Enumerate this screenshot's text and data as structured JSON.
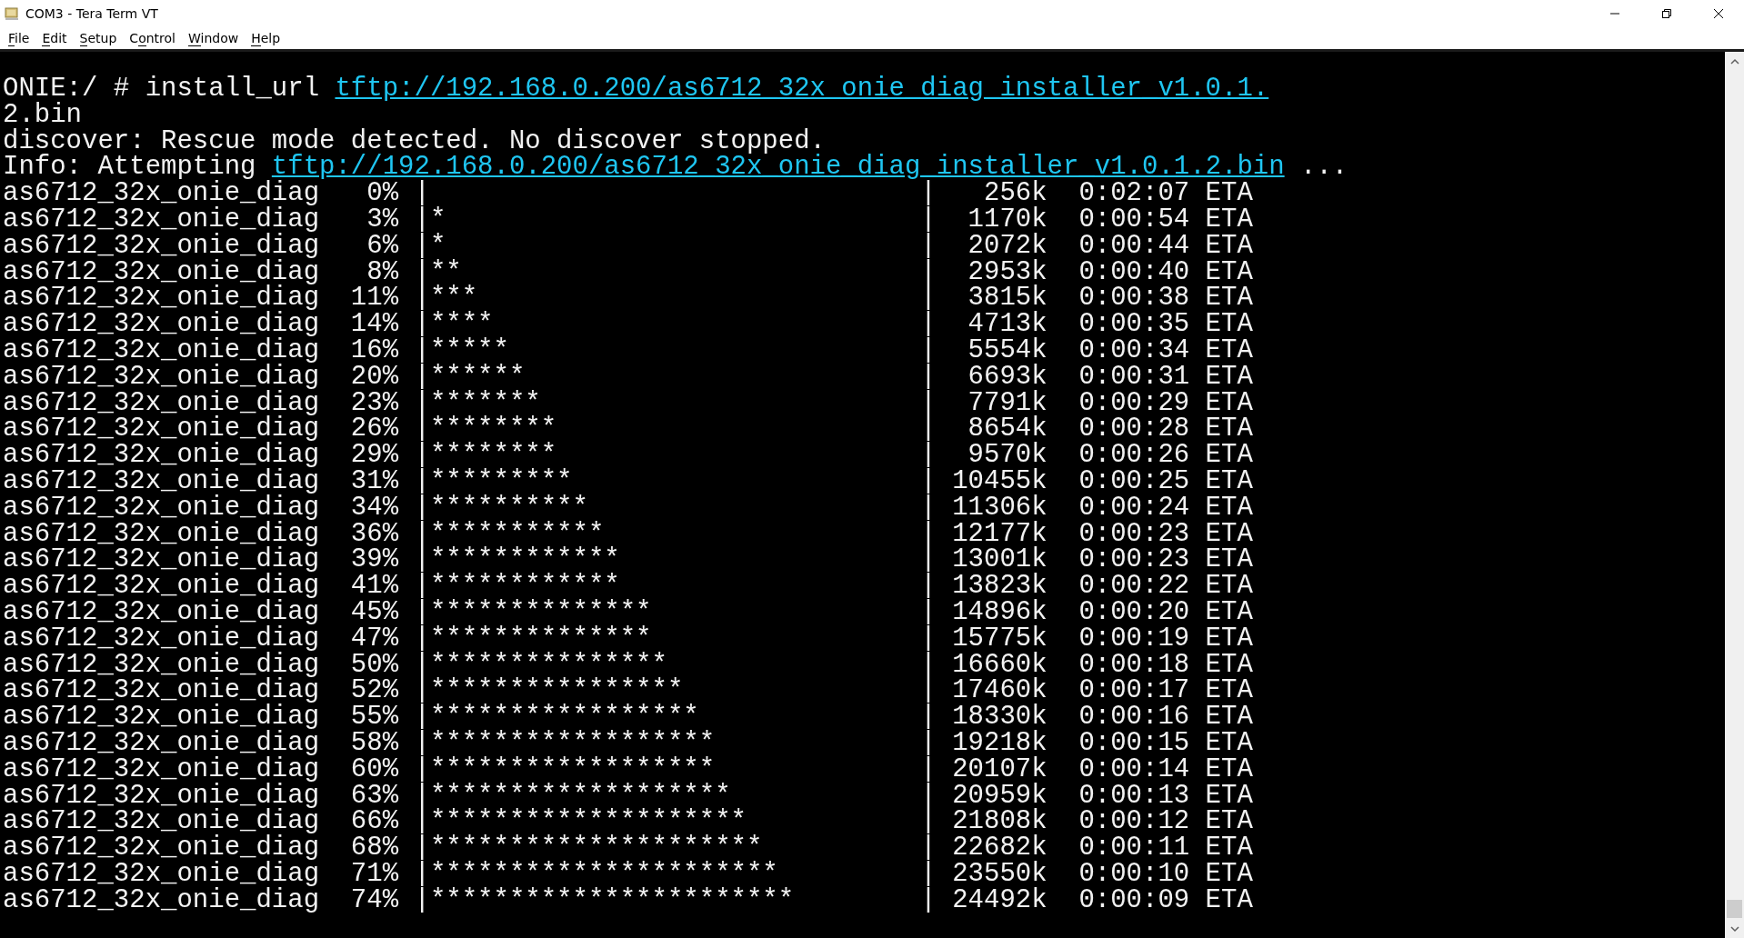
{
  "window": {
    "title": "COM3 - Tera Term VT"
  },
  "menu": [
    {
      "key": "F",
      "after": "ile"
    },
    {
      "key": "E",
      "after": "dit"
    },
    {
      "key": "S",
      "after": "etup"
    },
    {
      "before": "C",
      "key": "o",
      "after": "ntrol"
    },
    {
      "key": "W",
      "after": "indow"
    },
    {
      "key": "H",
      "after": "elp"
    }
  ],
  "terminal": {
    "lines": [
      {
        "kind": "link",
        "text": "ONIE:/ # install_url ",
        "link": "tftp://192.168.0.200/as6712_32x_onie_diag_installer_v1.0.1."
      },
      {
        "kind": "text",
        "text": "2.bin"
      },
      {
        "kind": "text",
        "text": "discover: Rescue mode detected. No discover stopped."
      },
      {
        "kind": "link",
        "text": "Info: Attempting ",
        "link": "tftp://192.168.0.200/as6712_32x_onie_diag_installer_v1.0.1.2.bin",
        "after": " ..."
      },
      {
        "kind": "text",
        "text": "as6712_32x_onie_diag   0% |                               |   256k  0:02:07 ETA"
      },
      {
        "kind": "text",
        "text": "as6712_32x_onie_diag   3% |*                              |  1170k  0:00:54 ETA"
      },
      {
        "kind": "text",
        "text": "as6712_32x_onie_diag   6% |*                              |  2072k  0:00:44 ETA"
      },
      {
        "kind": "text",
        "text": "as6712_32x_onie_diag   8% |**                             |  2953k  0:00:40 ETA"
      },
      {
        "kind": "text",
        "text": "as6712_32x_onie_diag  11% |***                            |  3815k  0:00:38 ETA"
      },
      {
        "kind": "text",
        "text": "as6712_32x_onie_diag  14% |****                           |  4713k  0:00:35 ETA"
      },
      {
        "kind": "text",
        "text": "as6712_32x_onie_diag  16% |*****                          |  5554k  0:00:34 ETA"
      },
      {
        "kind": "text",
        "text": "as6712_32x_onie_diag  20% |******                         |  6693k  0:00:31 ETA"
      },
      {
        "kind": "text",
        "text": "as6712_32x_onie_diag  23% |*******                        |  7791k  0:00:29 ETA"
      },
      {
        "kind": "text",
        "text": "as6712_32x_onie_diag  26% |********                       |  8654k  0:00:28 ETA"
      },
      {
        "kind": "text",
        "text": "as6712_32x_onie_diag  29% |********                       |  9570k  0:00:26 ETA"
      },
      {
        "kind": "text",
        "text": "as6712_32x_onie_diag  31% |*********                      | 10455k  0:00:25 ETA"
      },
      {
        "kind": "text",
        "text": "as6712_32x_onie_diag  34% |**********                     | 11306k  0:00:24 ETA"
      },
      {
        "kind": "text",
        "text": "as6712_32x_onie_diag  36% |***********                    | 12177k  0:00:23 ETA"
      },
      {
        "kind": "text",
        "text": "as6712_32x_onie_diag  39% |************                   | 13001k  0:00:23 ETA"
      },
      {
        "kind": "text",
        "text": "as6712_32x_onie_diag  41% |************                   | 13823k  0:00:22 ETA"
      },
      {
        "kind": "text",
        "text": "as6712_32x_onie_diag  45% |**************                 | 14896k  0:00:20 ETA"
      },
      {
        "kind": "text",
        "text": "as6712_32x_onie_diag  47% |**************                 | 15775k  0:00:19 ETA"
      },
      {
        "kind": "text",
        "text": "as6712_32x_onie_diag  50% |***************                | 16660k  0:00:18 ETA"
      },
      {
        "kind": "text",
        "text": "as6712_32x_onie_diag  52% |****************               | 17460k  0:00:17 ETA"
      },
      {
        "kind": "text",
        "text": "as6712_32x_onie_diag  55% |*****************              | 18330k  0:00:16 ETA"
      },
      {
        "kind": "text",
        "text": "as6712_32x_onie_diag  58% |******************             | 19218k  0:00:15 ETA"
      },
      {
        "kind": "text",
        "text": "as6712_32x_onie_diag  60% |******************             | 20107k  0:00:14 ETA"
      },
      {
        "kind": "text",
        "text": "as6712_32x_onie_diag  63% |*******************            | 20959k  0:00:13 ETA"
      },
      {
        "kind": "text",
        "text": "as6712_32x_onie_diag  66% |********************           | 21808k  0:00:12 ETA"
      },
      {
        "kind": "text",
        "text": "as6712_32x_onie_diag  68% |*********************          | 22682k  0:00:11 ETA"
      },
      {
        "kind": "text",
        "text": "as6712_32x_onie_diag  71% |**********************         | 23550k  0:00:10 ETA"
      },
      {
        "kind": "text",
        "text": "as6712_32x_onie_diag  74% |***********************        | 24492k  0:00:09 ETA"
      }
    ]
  }
}
